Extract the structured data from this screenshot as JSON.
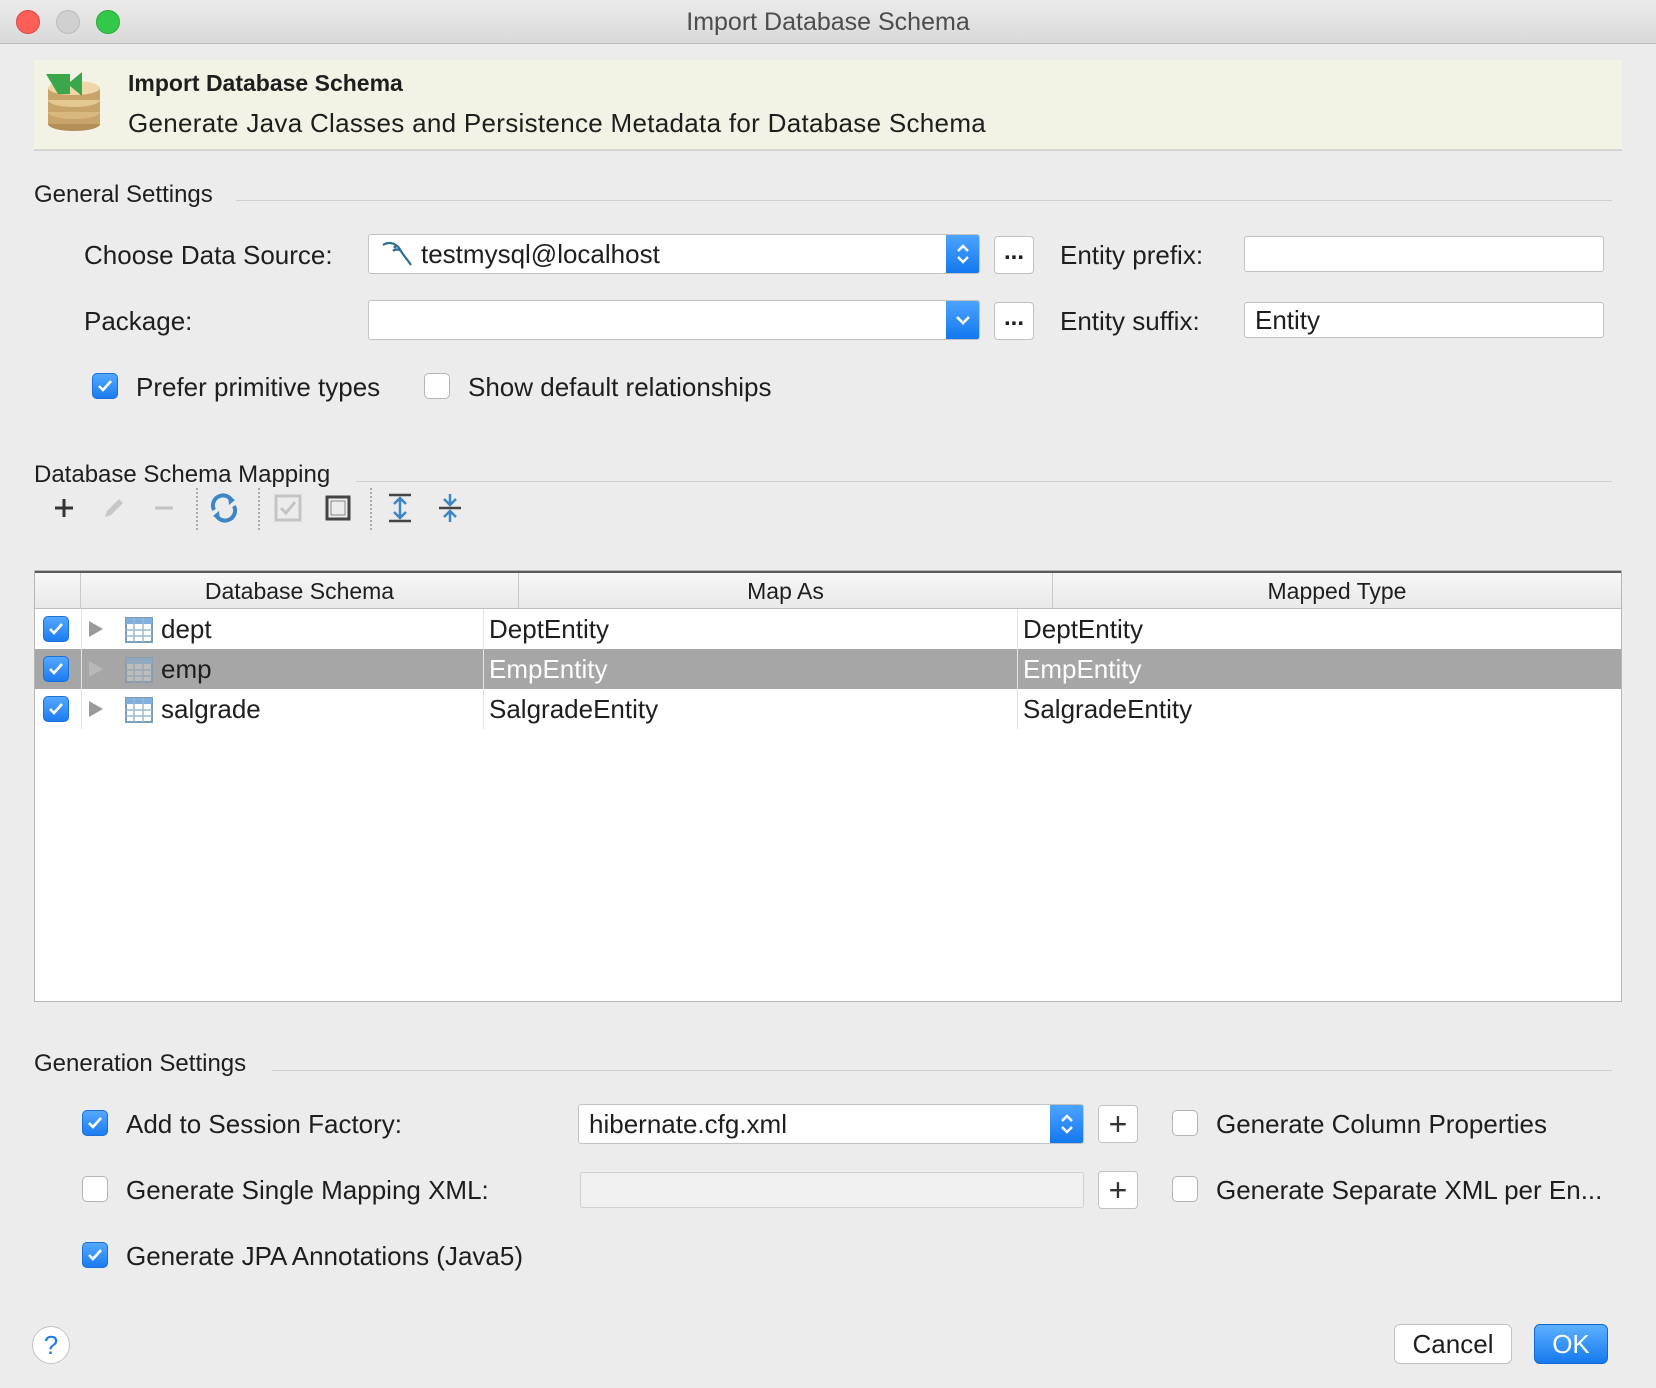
{
  "window": {
    "title": "Import Database Schema"
  },
  "banner": {
    "title": "Import Database Schema",
    "subtitle": "Generate Java Classes and Persistence Metadata for Database Schema"
  },
  "general": {
    "section_title": "General Settings",
    "data_source_label": "Choose Data Source:",
    "data_source_value": "testmysql@localhost",
    "package_label": "Package:",
    "package_value": "",
    "ellipsis": "...",
    "entity_prefix_label": "Entity prefix:",
    "entity_prefix_value": "",
    "entity_suffix_label": "Entity suffix:",
    "entity_suffix_value": "Entity",
    "prefer_primitive_label": "Prefer primitive types",
    "prefer_primitive_checked": true,
    "show_default_rel_label": "Show default relationships",
    "show_default_rel_checked": false
  },
  "mapping": {
    "section_title": "Database Schema Mapping",
    "toolbar": [
      "add-icon",
      "edit-icon",
      "remove-icon",
      "refresh-icon",
      "select-all-icon",
      "unselect-all-icon",
      "expand-all-icon",
      "collapse-all-icon"
    ],
    "columns": [
      "Database Schema",
      "Map As",
      "Mapped Type"
    ],
    "rows": [
      {
        "checked": true,
        "schema": "dept",
        "map_as": "DeptEntity",
        "mapped_type": "DeptEntity",
        "selected": false
      },
      {
        "checked": true,
        "schema": "emp",
        "map_as": "EmpEntity",
        "mapped_type": "EmpEntity",
        "selected": true
      },
      {
        "checked": true,
        "schema": "salgrade",
        "map_as": "SalgradeEntity",
        "mapped_type": "SalgradeEntity",
        "selected": false
      }
    ]
  },
  "generation": {
    "section_title": "Generation Settings",
    "add_session_label": "Add to Session Factory:",
    "add_session_checked": true,
    "session_file": "hibernate.cfg.xml",
    "single_mapping_label": "Generate Single Mapping XML:",
    "single_mapping_checked": false,
    "single_mapping_value": "",
    "jpa_label": "Generate JPA Annotations (Java5)",
    "jpa_checked": true,
    "column_props_label": "Generate Column Properties",
    "column_props_checked": false,
    "separate_xml_label": "Generate Separate XML per En...",
    "separate_xml_checked": false,
    "plus": "+"
  },
  "footer": {
    "help": "?",
    "cancel": "Cancel",
    "ok": "OK"
  },
  "colors": {
    "accent": "#1a7cf0",
    "selected_row": "#a6a6a6",
    "banner_bg": "#f2f3e5"
  }
}
